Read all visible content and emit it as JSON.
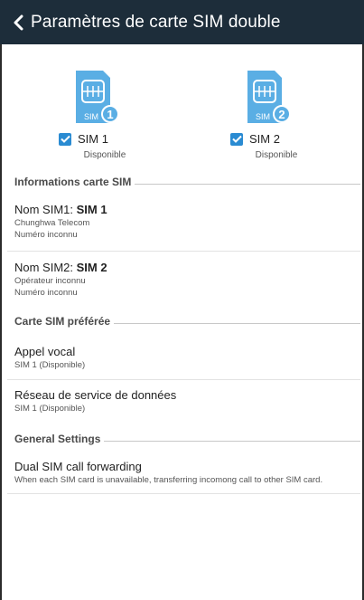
{
  "app_bar": {
    "title": "Paramètres de carte SIM double",
    "background": "#1d2d3a"
  },
  "sims": [
    {
      "icon_label": "SIM",
      "badge": "1",
      "checkbox_label": "SIM 1",
      "status": "Disponible",
      "checked": true
    },
    {
      "icon_label": "SIM",
      "badge": "2",
      "checkbox_label": "SIM 2",
      "status": "Disponible",
      "checked": true
    }
  ],
  "sections": {
    "info_title": "Informations carte SIM",
    "preferred_title": "Carte SIM préférée",
    "general_title": "General Settings"
  },
  "sim_info": [
    {
      "name_prefix": "Nom SIM1: ",
      "name_value": "SIM 1",
      "carrier": "Chunghwa Telecom",
      "number": "Numéro inconnu"
    },
    {
      "name_prefix": "Nom SIM2: ",
      "name_value": "SIM 2",
      "carrier": "Opérateur inconnu",
      "number": "Numéro inconnu"
    }
  ],
  "preferred": [
    {
      "title": "Appel vocal",
      "subtitle": "SIM 1 (Disponible)"
    },
    {
      "title": "Réseau de service de données",
      "subtitle": "SIM 1 (Disponible)"
    }
  ],
  "general": [
    {
      "title": "Dual SIM call forwarding",
      "subtitle": "When each SIM card is unavailable, transferring incomong call to other SIM card."
    }
  ],
  "colors": {
    "accent": "#2a8bd2",
    "sim_icon": "#5aaee4"
  },
  "icons": {
    "back": "chevron-left-icon",
    "sim": "sim-card-icon",
    "check": "check-icon"
  }
}
